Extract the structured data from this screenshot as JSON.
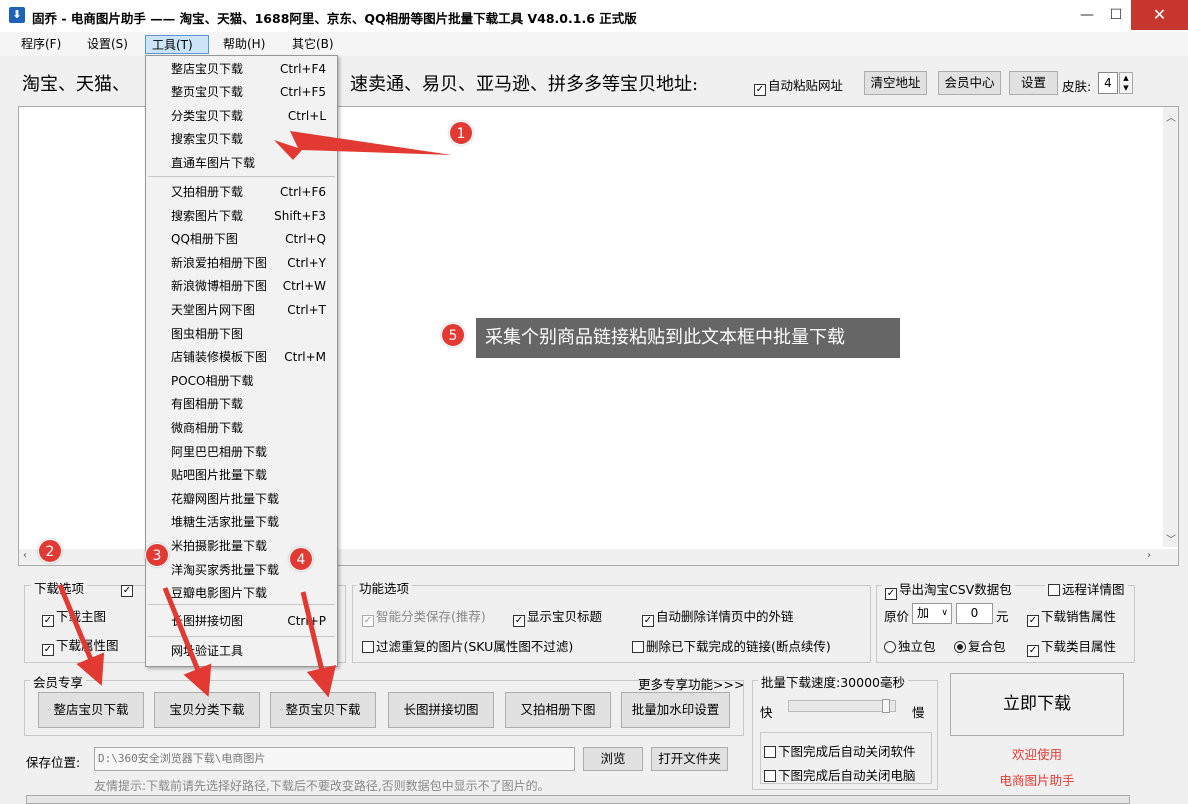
{
  "window": {
    "title": "固乔 - 电商图片助手 —— 淘宝、天猫、1688阿里、京东、QQ相册等图片批量下载工具 V48.0.1.6 正式版",
    "icon_glyph": "⬇",
    "minimize_glyph": "—",
    "maximize_glyph": "☐",
    "close_glyph": "✕"
  },
  "menubar": {
    "items": [
      {
        "label": "程序(F)"
      },
      {
        "label": "设置(S)"
      },
      {
        "label": "工具(T)"
      },
      {
        "label": "帮助(H)"
      },
      {
        "label": "其它(B)"
      }
    ]
  },
  "toolbar": {
    "url_label_left": "淘宝、天猫、",
    "url_label_right": "速卖通、易贝、亚马逊、拼多多等宝贝地址:",
    "auto_paste_label": "自动粘贴网址",
    "auto_paste_checked": true,
    "clear_button": "清空地址",
    "member_button": "会员中心",
    "settings_button": "设置",
    "skin_label": "皮肤:",
    "skin_value": "4"
  },
  "tools_menu": {
    "group1": [
      {
        "label": "整店宝贝下载",
        "shortcut": "Ctrl+F4"
      },
      {
        "label": "整页宝贝下载",
        "shortcut": "Ctrl+F5"
      },
      {
        "label": "分类宝贝下载",
        "shortcut": "Ctrl+L"
      },
      {
        "label": "搜索宝贝下载",
        "shortcut": ""
      },
      {
        "label": "直通车图片下载",
        "shortcut": ""
      }
    ],
    "group2": [
      {
        "label": "又拍相册下载",
        "shortcut": "Ctrl+F6"
      },
      {
        "label": "搜索图片下载",
        "shortcut": "Shift+F3"
      },
      {
        "label": "QQ相册下图",
        "shortcut": "Ctrl+Q"
      },
      {
        "label": "新浪爱拍相册下图",
        "shortcut": "Ctrl+Y"
      },
      {
        "label": "新浪微博相册下图",
        "shortcut": "Ctrl+W"
      },
      {
        "label": "天堂图片网下图",
        "shortcut": "Ctrl+T"
      },
      {
        "label": "图虫相册下图",
        "shortcut": ""
      },
      {
        "label": "店铺装修模板下图",
        "shortcut": "Ctrl+M"
      },
      {
        "label": "POCO相册下载",
        "shortcut": ""
      },
      {
        "label": "有图相册下载",
        "shortcut": ""
      },
      {
        "label": "微商相册下载",
        "shortcut": ""
      },
      {
        "label": "阿里巴巴相册下载",
        "shortcut": ""
      },
      {
        "label": "贴吧图片批量下载",
        "shortcut": ""
      },
      {
        "label": "花瓣网图片批量下载",
        "shortcut": ""
      },
      {
        "label": "堆糖生活家批量下载",
        "shortcut": ""
      },
      {
        "label": "米拍摄影批量下载",
        "shortcut": ""
      },
      {
        "label": "洋淘买家秀批量下载",
        "shortcut": ""
      },
      {
        "label": "豆瓣电影图片下载",
        "shortcut": ""
      }
    ],
    "group3": [
      {
        "label": "长图拼接切图",
        "shortcut": "Ctrl+P"
      }
    ],
    "group4": [
      {
        "label": "网址验证工具",
        "shortcut": ""
      }
    ]
  },
  "download_options": {
    "title": "下载选项",
    "main_pic_label": "下载主图",
    "main_pic_checked": true,
    "attr_pic_label": "下载属性图",
    "attr_pic_checked": true
  },
  "function_options": {
    "title": "功能选项",
    "smart_save_label": "智能分类保存(推荐)",
    "show_title_label": "显示宝贝标题",
    "auto_delete_label": "自动删除详情页中的外链",
    "filter_dup_label": "过滤重复的图片(SKU属性图不过滤)",
    "delete_done_label": "删除已下载完成的链接(断点续传)"
  },
  "csv_options": {
    "export_csv_label": "导出淘宝CSV数据包",
    "remote_detail_label": "远程详情图",
    "price_label": "原价",
    "price_op": "加",
    "price_value": "0",
    "price_unit": "元",
    "sales_attr_label": "下载销售属性",
    "standalone_label": "独立包",
    "composite_label": "复合包",
    "category_attr_label": "下载类目属性"
  },
  "member_zone": {
    "title": "会员专享",
    "more_link": "更多专享功能>>>",
    "buttons": [
      "整店宝贝下载",
      "宝贝分类下载",
      "整页宝贝下载",
      "长图拼接切图",
      "又拍相册下图",
      "批量加水印设置"
    ]
  },
  "speed": {
    "label": "批量下载速度:30000毫秒",
    "fast": "快",
    "slow": "慢",
    "level": 0.95,
    "auto_close_app": "下图完成后自动关闭软件",
    "auto_close_pc": "下图完成后自动关闭电脑"
  },
  "download_now": "立即下载",
  "welcome_line1": "欢迎使用",
  "welcome_line2": "电商图片助手",
  "save": {
    "label": "保存位置:",
    "path": "D:\\360安全浏览器下载\\电商图片",
    "browse": "浏览",
    "open_folder": "打开文件夹",
    "tip": "友情提示:下载前请先选择好路径,下载后不要改变路径,否则数据包中显示不了图片的。"
  },
  "annotations": {
    "badges": [
      "1",
      "2",
      "3",
      "4",
      "5"
    ],
    "tip_text": "采集个别商品链接粘贴到此文本框中批量下载"
  },
  "colors": {
    "accent_red": "#e23a33",
    "close_red": "#c7372f",
    "menu_highlight": "#cce4f7"
  }
}
